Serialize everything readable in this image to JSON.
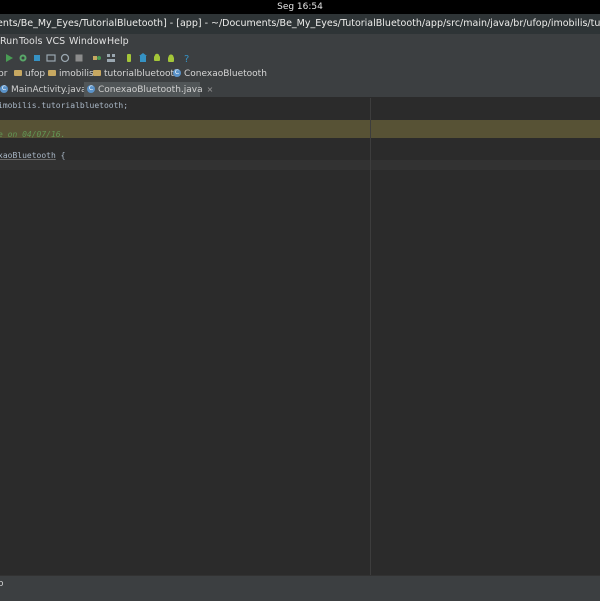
{
  "system_bar": {
    "clock": "Seg 16:54"
  },
  "window": {
    "title": "ents/Be_My_Eyes/TutorialBluetooth] - [app] - ~/Documents/Be_My_Eyes/TutorialBluetooth/app/src/main/java/br/ufop/imobilis/tutorialbluetooth/ConexaoBluetooth.java"
  },
  "menu": [
    "Run",
    "Tools",
    "VCS",
    "Window",
    "Help"
  ],
  "breadcrumb": [
    {
      "label": "br",
      "type": "folder"
    },
    {
      "label": "ufop",
      "type": "folder"
    },
    {
      "label": "imobilis",
      "type": "folder"
    },
    {
      "label": "tutorialbluetooth",
      "type": "folder"
    },
    {
      "label": "ConexaoBluetooth",
      "type": "class"
    }
  ],
  "tabs": [
    {
      "label": "MainActivity.java",
      "active": false
    },
    {
      "label": "ConexaoBluetooth.java",
      "active": true
    }
  ],
  "code": {
    "package_line": "imobilis.tutorialbluetooth;",
    "comment_line": "e on 04/07/16.",
    "class_name": "xaoBluetooth",
    "class_brace": " {"
  },
  "status": {
    "text": "o"
  },
  "colors": {
    "editor_bg": "#2b2b2b",
    "chrome_bg": "#3c3f41",
    "comment_highlight": "#575235",
    "comment_text": "#629755",
    "keyword": "#cc7832",
    "run_green": "#499c54",
    "class_icon": "#5b93c9"
  }
}
